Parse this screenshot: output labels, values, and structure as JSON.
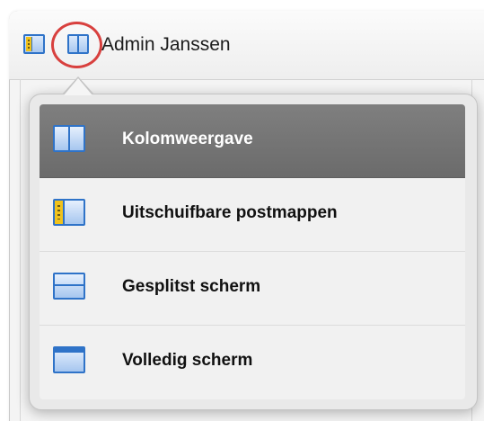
{
  "toolbar": {
    "account_name": "Admin Janssen",
    "icons": [
      "sidebar-layout-icon",
      "column-layout-icon"
    ],
    "highlight_color": "#d8403e"
  },
  "layout_menu": {
    "items": [
      {
        "label": "Kolomweergave",
        "icon": "column-view-icon",
        "selected": true
      },
      {
        "label": "Uitschuifbare postmappen",
        "icon": "slide-out-folders-icon",
        "selected": false
      },
      {
        "label": "Gesplitst scherm",
        "icon": "split-screen-icon",
        "selected": false
      },
      {
        "label": "Volledig scherm",
        "icon": "full-screen-icon",
        "selected": false
      }
    ],
    "selected_background": "#767676",
    "icon_color": "#2f73c8"
  }
}
